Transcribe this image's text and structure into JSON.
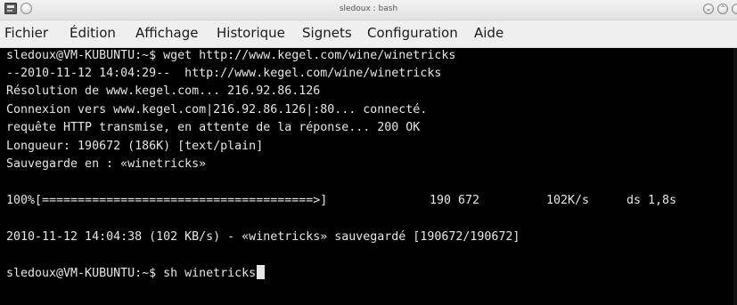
{
  "window": {
    "title": "sledoux : bash"
  },
  "menu": {
    "items": [
      "Fichier",
      "Édition",
      "Affichage",
      "Historique",
      "Signets",
      "Configuration",
      "Aide"
    ]
  },
  "terminal": {
    "lines": [
      "sledoux@VM-KUBUNTU:~$ wget http://www.kegel.com/wine/winetricks",
      "--2010-11-12 14:04:29--  http://www.kegel.com/wine/winetricks",
      "Résolution de www.kegel.com... 216.92.86.126",
      "Connexion vers www.kegel.com|216.92.86.126|:80... connecté.",
      "requête HTTP transmise, en attente de la réponse... 200 OK",
      "Longueur: 190672 (186K) [text/plain]",
      "Sauvegarde en : «winetricks»"
    ],
    "progress": {
      "bar": "100%[======================================>]",
      "size": "190 672",
      "speed": "102K/s",
      "time": "ds 1,8s",
      "percent": 100
    },
    "saved_line": "2010-11-12 14:04:38 (102 KB/s) - «winetricks» sauvegardé [190672/190672]",
    "current_command": "sledoux@VM-KUBUNTU:~$ sh winetricks"
  }
}
